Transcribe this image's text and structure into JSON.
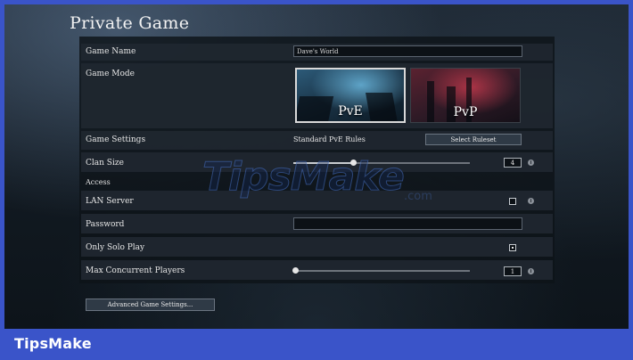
{
  "title": "Private Game",
  "fields": {
    "game_name": {
      "label": "Game Name",
      "value": "Dave's World"
    },
    "game_mode": {
      "label": "Game Mode",
      "options": [
        "PvE",
        "PvP"
      ],
      "selected": "PvE"
    },
    "game_settings": {
      "label": "Game Settings",
      "value": "Standard PvE Rules",
      "button": "Select Ruleset"
    },
    "clan_size": {
      "label": "Clan Size",
      "value": "4",
      "slider_fraction": 0.3
    },
    "access": {
      "label": "Access"
    },
    "lan_server": {
      "label": "LAN Server",
      "checked": false
    },
    "password": {
      "label": "Password",
      "value": ""
    },
    "only_solo_play": {
      "label": "Only Solo Play",
      "checked": true
    },
    "max_players": {
      "label": "Max Concurrent Players",
      "value": "1",
      "slider_fraction": 0.0
    }
  },
  "info_icon": "i",
  "advanced_button": "Advanced Game Settings...",
  "watermark": {
    "main": "TipsMake",
    "suffix": ".com"
  },
  "brand": "TipsMake",
  "colors": {
    "border": "#3a54c9",
    "panel": "#0e1319",
    "row": "#202730"
  }
}
